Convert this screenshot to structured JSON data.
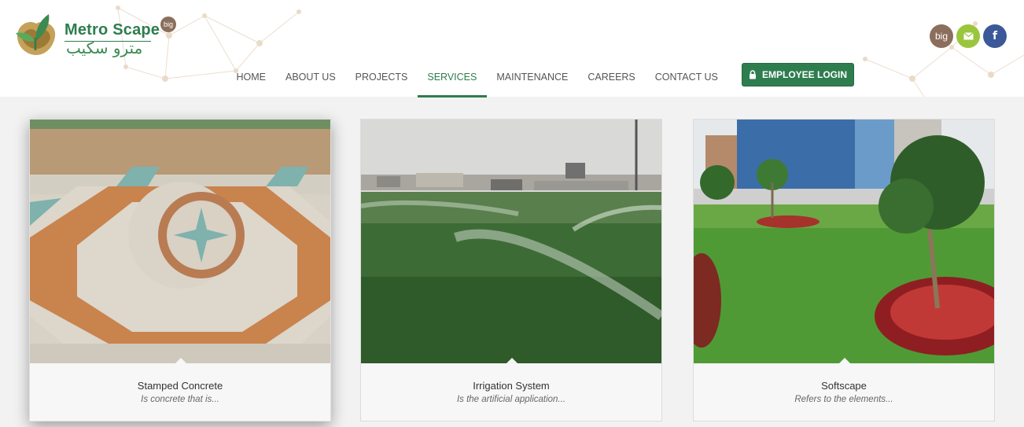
{
  "brand": {
    "name": "Metro Scape",
    "arabic": "مترو سكيب",
    "badge": "big"
  },
  "nav": {
    "items": [
      {
        "label": "HOME",
        "active": false
      },
      {
        "label": "ABOUT US",
        "active": false
      },
      {
        "label": "PROJECTS",
        "active": false
      },
      {
        "label": "SERVICES",
        "active": true
      },
      {
        "label": "MAINTENANCE",
        "active": false
      },
      {
        "label": "CAREERS",
        "active": false
      },
      {
        "label": "CONTACT US",
        "active": false
      }
    ]
  },
  "login": {
    "label": "EMPLOYEE LOGIN",
    "icon": "lock-icon"
  },
  "social": {
    "big_label": "big",
    "mail_icon": "mail-icon",
    "facebook_label": "f"
  },
  "services": [
    {
      "title": "Stamped Concrete",
      "description": "Is concrete that is...",
      "image": "stamped-concrete-photo"
    },
    {
      "title": "Irrigation System",
      "description": "Is the artificial application...",
      "image": "irrigation-photo"
    },
    {
      "title": "Softscape",
      "description": "Refers to the elements...",
      "image": "softscape-photo"
    }
  ],
  "colors": {
    "brand_green": "#2e7d4f",
    "big_brown": "#8b6f5c",
    "mail_green": "#9bc53d",
    "facebook_blue": "#3b5998"
  }
}
